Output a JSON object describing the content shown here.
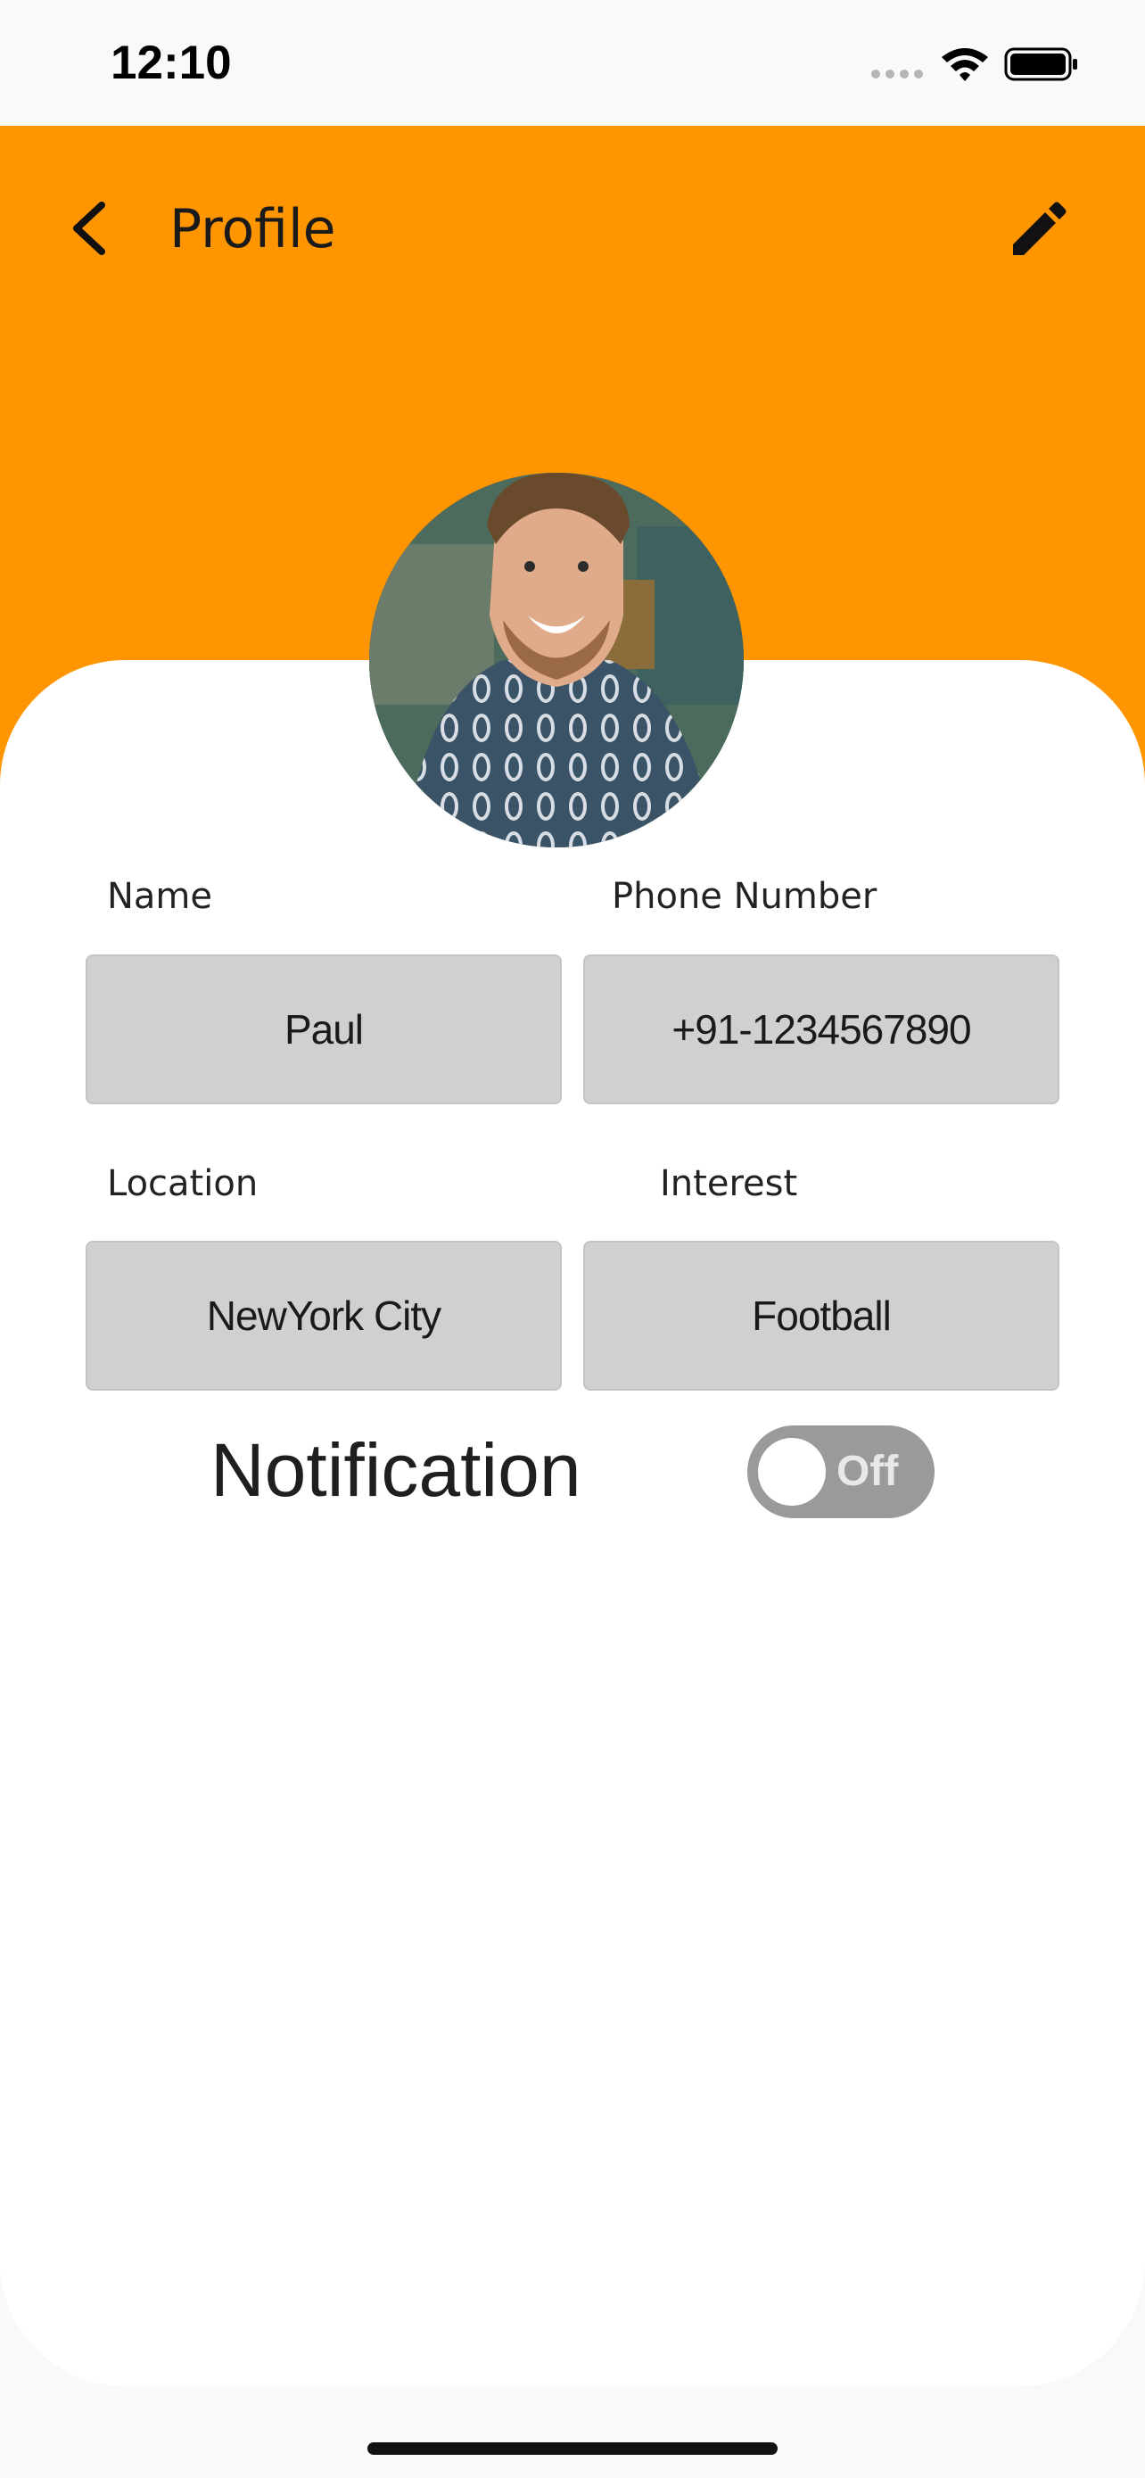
{
  "status_bar": {
    "time": "12:10"
  },
  "header": {
    "title": "Profile"
  },
  "profile": {
    "fields": [
      {
        "label": "Name",
        "value": "Paul"
      },
      {
        "label": "Phone Number",
        "value": "+91-1234567890"
      },
      {
        "label": "Location",
        "value": "NewYork City"
      },
      {
        "label": "Interest",
        "value": "Football"
      }
    ],
    "notification": {
      "label": "Notification",
      "state_label": "Off",
      "enabled": false
    }
  },
  "colors": {
    "header": "#ff9500",
    "field_bg": "#d0d0d0",
    "toggle_off": "#9a9a9a"
  }
}
